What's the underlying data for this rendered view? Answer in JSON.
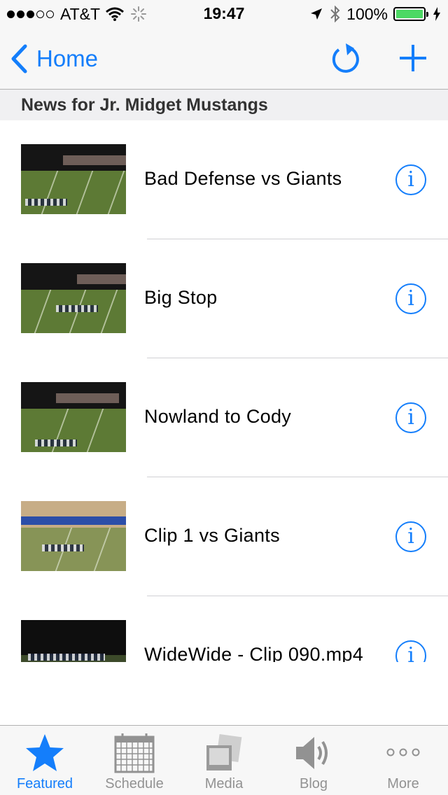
{
  "status_bar": {
    "carrier": "AT&T",
    "signal_dots_filled": 3,
    "signal_dots_total": 5,
    "time": "19:47",
    "battery_percent": "100%",
    "battery_color": "#4cd964"
  },
  "nav": {
    "back_label": "Home",
    "back_icon": "chevron-left-icon",
    "refresh_icon": "refresh-icon",
    "add_icon": "plus-icon"
  },
  "section": {
    "title": "News for Jr. Midget Mustangs"
  },
  "items": [
    {
      "title": "Bad Defense vs Giants"
    },
    {
      "title": "Big Stop"
    },
    {
      "title": "Nowland to Cody"
    },
    {
      "title": "Clip 1 vs Giants"
    },
    {
      "title": "WideWide - Clip 090.mp4"
    }
  ],
  "tabs": [
    {
      "label": "Featured",
      "icon": "star-icon",
      "active": true
    },
    {
      "label": "Schedule",
      "icon": "calendar-icon",
      "active": false
    },
    {
      "label": "Media",
      "icon": "photos-icon",
      "active": false
    },
    {
      "label": "Blog",
      "icon": "speaker-icon",
      "active": false
    },
    {
      "label": "More",
      "icon": "more-icon",
      "active": false
    }
  ],
  "colors": {
    "accent": "#147efb",
    "inactive_tab": "#929292"
  }
}
